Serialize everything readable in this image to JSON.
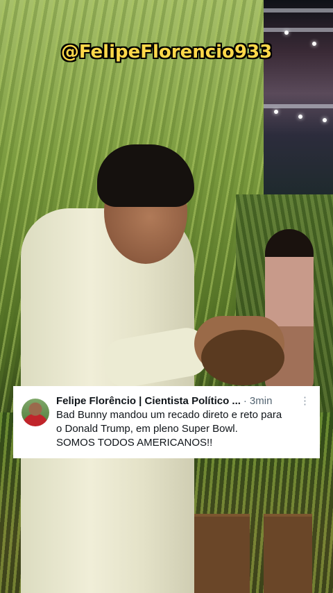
{
  "watermark": {
    "handle": "@FelipeFlorencio933"
  },
  "tweet": {
    "author": "Felipe Florêncio | Cientista Político ...",
    "separator": "·",
    "time": "3min",
    "more_glyph": "⋮",
    "lines": [
      "Bad Bunny mandou um recado direto e reto para",
      "o Donald Trump, em pleno Super Bowl.",
      "SOMOS TODOS AMERICANOS!!"
    ]
  },
  "colors": {
    "watermark_text": "#ffd84a",
    "card_background": "#ffffff",
    "secondary_text": "#536471"
  },
  "icons": {
    "avatar": "profile-avatar",
    "more": "more-options-icon"
  }
}
